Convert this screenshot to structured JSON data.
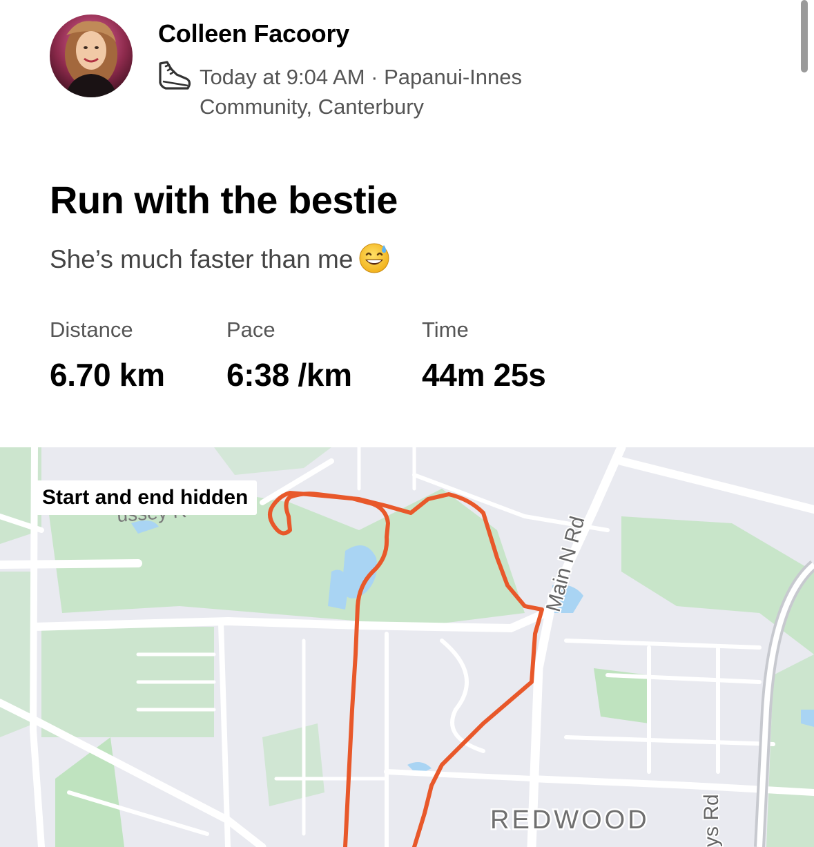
{
  "athlete": {
    "name": "Colleen Facoory",
    "activity_icon": "running-shoe-icon",
    "meta": "Today at 9:04 AM · Papanui-Innes Community, Canterbury"
  },
  "activity": {
    "title": "Run with the bestie",
    "description": "She’s much faster than me",
    "description_emoji": "grinning-face-with-sweat-icon"
  },
  "stats": [
    {
      "label": "Distance",
      "value": "6.70 km"
    },
    {
      "label": "Pace",
      "value": "6:38 /km"
    },
    {
      "label": "Time",
      "value": "44m 25s"
    }
  ],
  "map": {
    "privacy_label": "Start and end hidden",
    "street_labels": [
      "Main N Rd",
      "REDWOOD",
      "ys Rd",
      "ussey R"
    ],
    "route_color": "#e8582a",
    "park_color": "#bfe3bf",
    "water_color": "#a9d4f3",
    "road_color": "#ffffff"
  }
}
